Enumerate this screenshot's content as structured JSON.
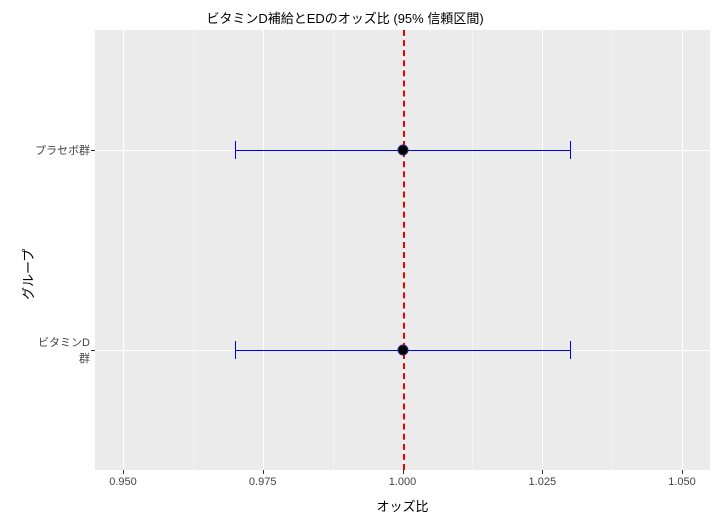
{
  "chart_data": {
    "type": "forest",
    "title": "ビタミンD補給とEDのオッズ比 (95% 信頼区間)",
    "xlabel": "オッズ比",
    "ylabel": "グループ",
    "xlim": [
      0.945,
      1.055
    ],
    "x_ticks": [
      0.95,
      0.975,
      1.0,
      1.025,
      1.05
    ],
    "reference_line": 1.0,
    "series": [
      {
        "name": "プラセボ群",
        "estimate": 1.0,
        "ci_low": 0.97,
        "ci_high": 1.03
      },
      {
        "name": "ビタミンD群",
        "estimate": 1.0,
        "ci_low": 0.97,
        "ci_high": 1.03
      }
    ]
  }
}
